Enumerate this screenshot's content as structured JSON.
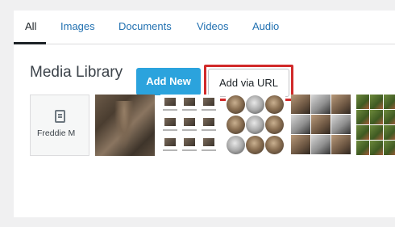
{
  "tabs": [
    {
      "label": "All",
      "active": true
    },
    {
      "label": "Images",
      "active": false
    },
    {
      "label": "Documents",
      "active": false
    },
    {
      "label": "Videos",
      "active": false
    },
    {
      "label": "Audio",
      "active": false
    }
  ],
  "header": {
    "title": "Media Library",
    "add_new_label": "Add New",
    "add_via_url_label": "Add via URL"
  },
  "media": {
    "items": [
      {
        "type": "document",
        "label": "Freddie M",
        "icon": "document-icon"
      },
      {
        "type": "image",
        "subject": "stone sculpture"
      },
      {
        "type": "image",
        "subject": "image grid"
      },
      {
        "type": "image",
        "subject": "circular ornaments"
      },
      {
        "type": "image",
        "subject": "architecture collage"
      },
      {
        "type": "image",
        "subject": "garden collage"
      }
    ]
  },
  "colors": {
    "accent": "#2271b1",
    "primary_button": "#2ba3dd",
    "highlight_border": "#d12a2a",
    "page_background": "#f0f0f1"
  }
}
